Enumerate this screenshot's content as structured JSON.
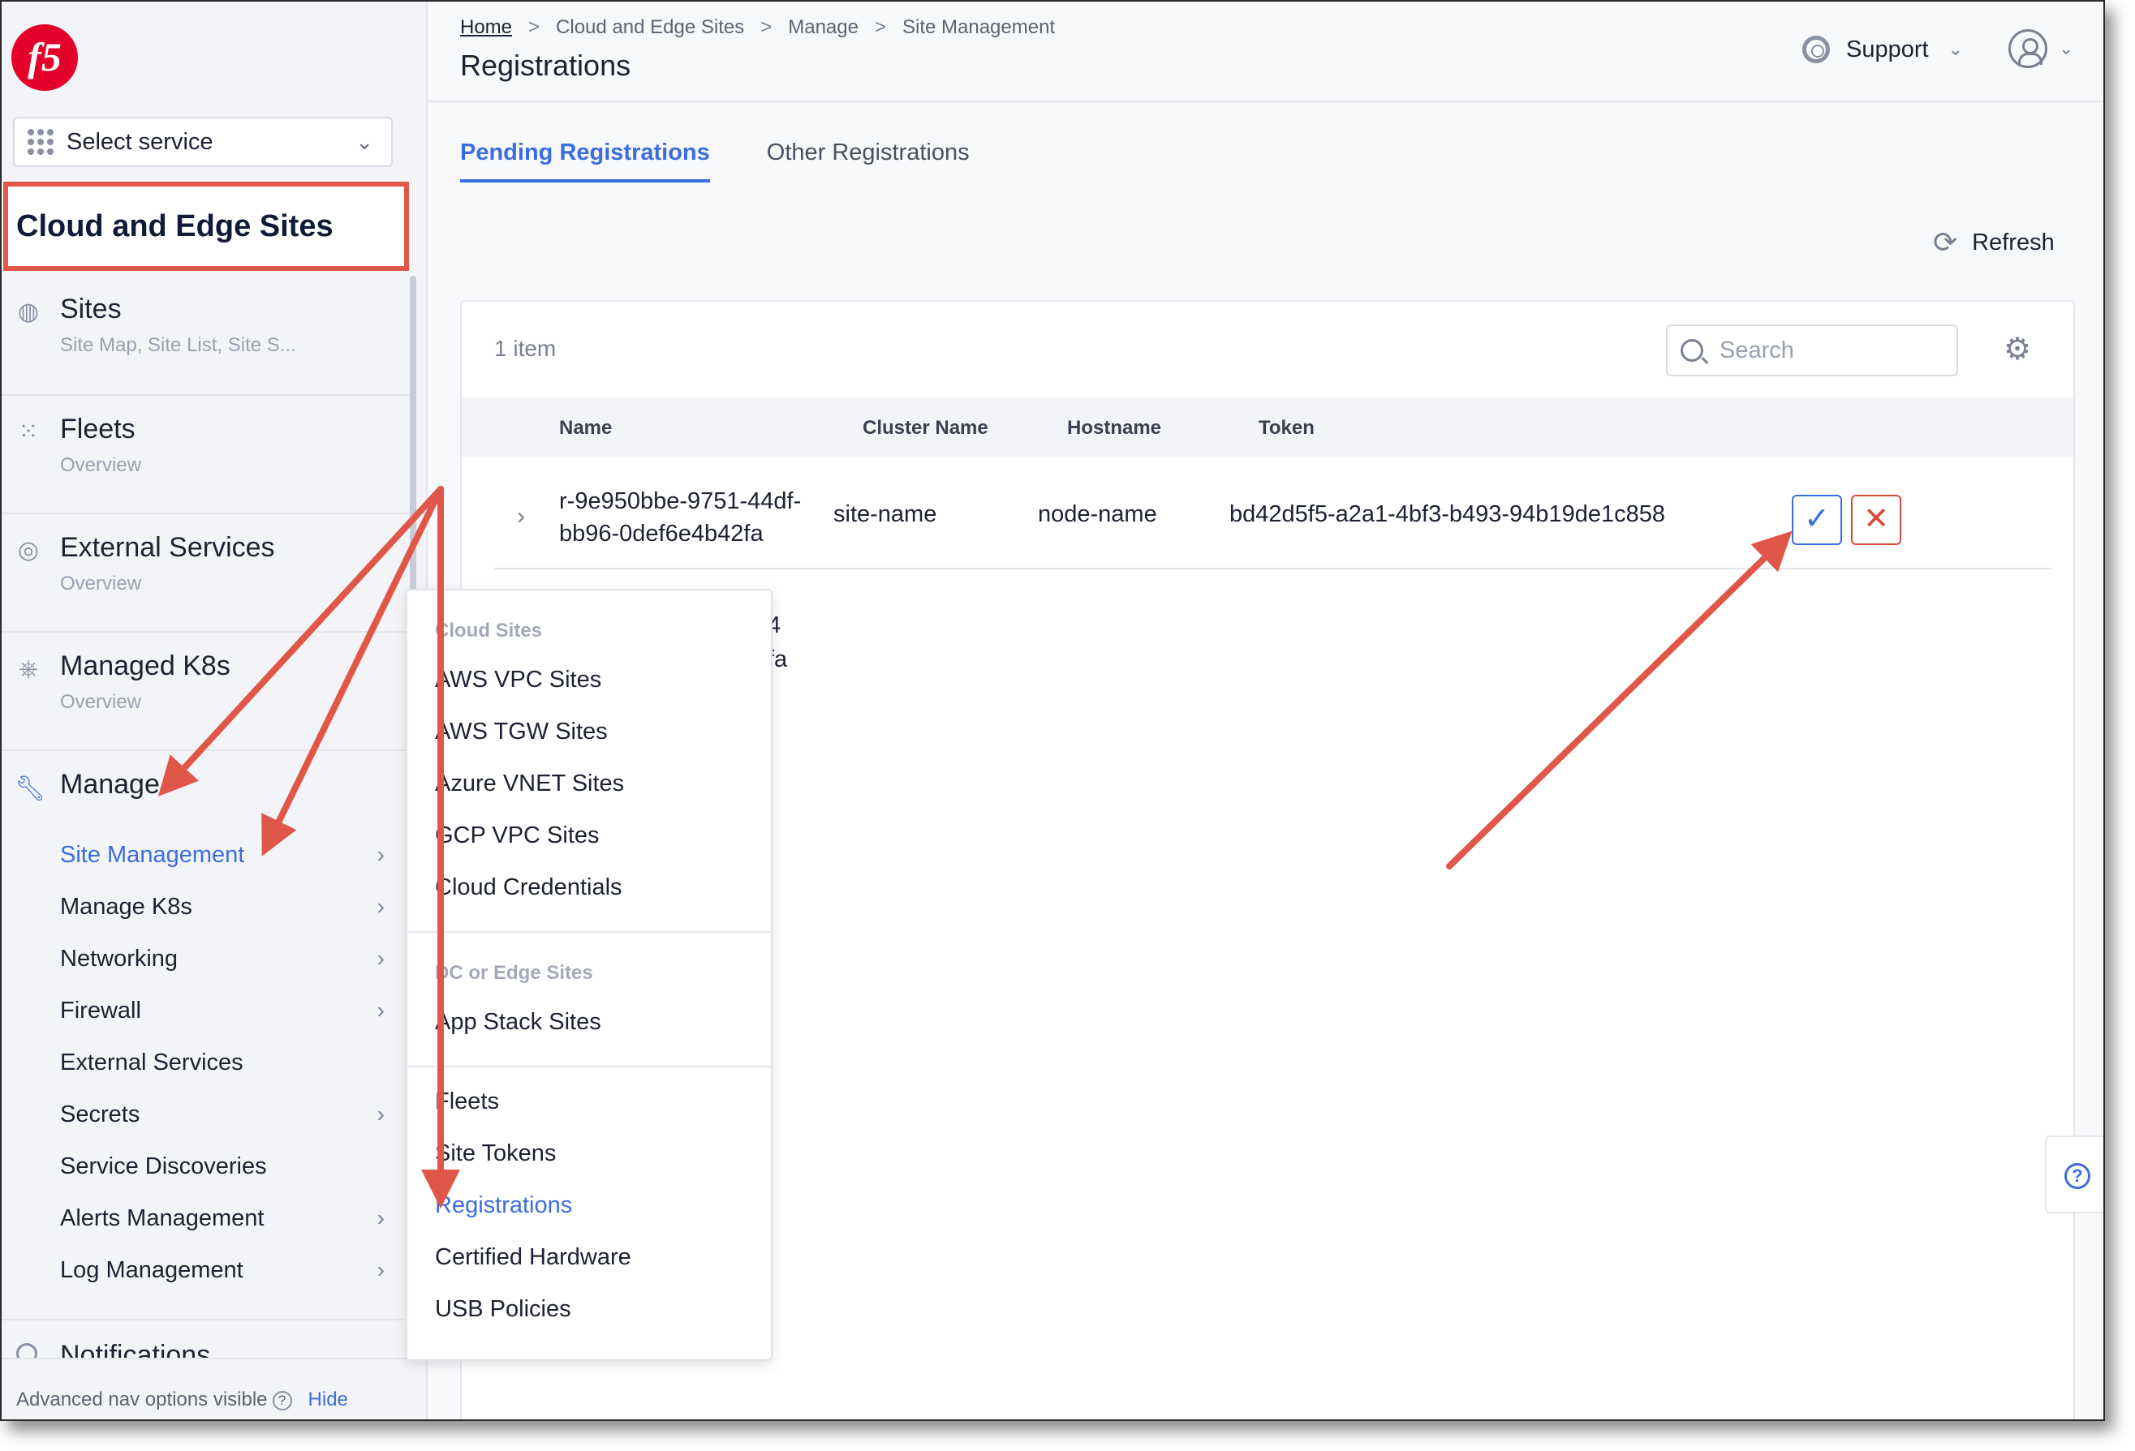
{
  "logo": {
    "text": "f5"
  },
  "sidebar": {
    "select_service": "Select service",
    "workspace_title": "Cloud and Edge Sites",
    "sections": [
      {
        "title": "Sites",
        "sub": "Site Map, Site List, Site S...",
        "icon": "globe-icon"
      },
      {
        "title": "Fleets",
        "sub": "Overview",
        "icon": "fleet-icon"
      },
      {
        "title": "External Services",
        "sub": "Overview",
        "icon": "external-services-icon"
      },
      {
        "title": "Managed K8s",
        "sub": "Overview",
        "icon": "k8s-wheel-icon"
      }
    ],
    "manage": {
      "title": "Manage",
      "icon": "wrench-icon"
    },
    "manage_items": [
      {
        "label": "Site Management",
        "arrow": "›"
      },
      {
        "label": "Manage K8s",
        "arrow": "›"
      },
      {
        "label": "Networking",
        "arrow": "›"
      },
      {
        "label": "Firewall",
        "arrow": "›"
      },
      {
        "label": "External Services",
        "arrow": ""
      },
      {
        "label": "Secrets",
        "arrow": "›"
      },
      {
        "label": "Service Discoveries",
        "arrow": ""
      },
      {
        "label": "Alerts Management",
        "arrow": "›"
      },
      {
        "label": "Log Management",
        "arrow": "›"
      }
    ],
    "notifications_partial": "Notifications",
    "advanced_nav": "Advanced nav options visible",
    "hide": "Hide"
  },
  "flyout": {
    "group1": "Cloud Sites",
    "group1_items": [
      "AWS VPC Sites",
      "AWS TGW Sites",
      "Azure VNET Sites",
      "GCP VPC Sites",
      "Cloud Credentials"
    ],
    "group2": "DC or Edge Sites",
    "group2_items": [
      "App Stack Sites"
    ],
    "group3_items": [
      "Fleets",
      "Site Tokens",
      "Registrations",
      "Certified Hardware",
      "USB Policies"
    ]
  },
  "header": {
    "breadcrumb": [
      "Home",
      "Cloud and Edge Sites",
      "Manage",
      "Site Management"
    ],
    "title": "Registrations",
    "support": "Support"
  },
  "tabs": [
    "Pending Registrations",
    "Other Registrations"
  ],
  "refresh": "Refresh",
  "table": {
    "item_count": "1 item",
    "search_placeholder": "Search",
    "columns": [
      "Name",
      "Cluster Name",
      "Hostname",
      "Token"
    ],
    "rows": [
      {
        "name_line1": "r-9e950bbe-9751-44df-",
        "name_line2": "bb96-0def6e4b42fa",
        "cluster": "site-name",
        "hostname": "node-name",
        "token": "bd42d5f5-a2a1-4bf3-b493-94b19de1c858"
      }
    ],
    "peek_line1": "4",
    "peek_line2": "fa"
  },
  "colors": {
    "accent": "#3b6de0",
    "annotation": "#e0574a",
    "reject": "#d84b3c",
    "brand": "#e4002b"
  }
}
